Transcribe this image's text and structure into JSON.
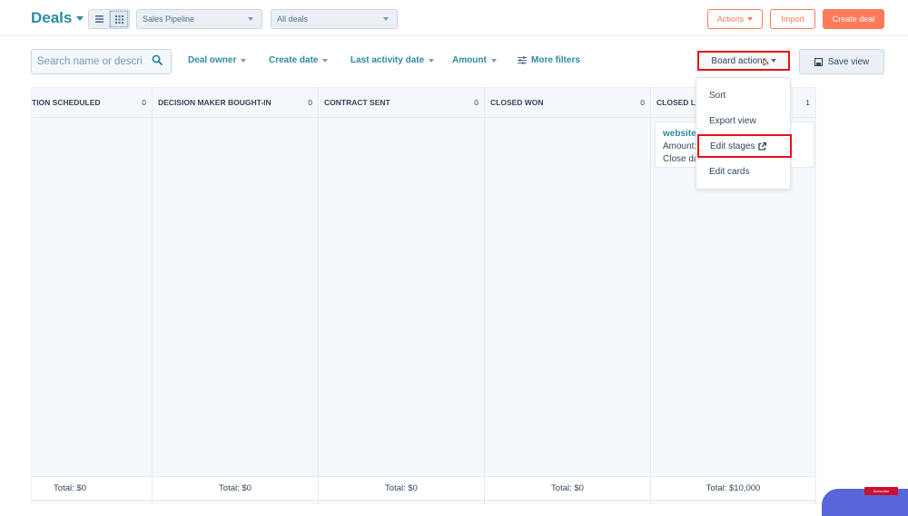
{
  "header": {
    "title": "Deals",
    "view_toggle": [
      {
        "icon": "list-view-icon",
        "active": false
      },
      {
        "icon": "board-view-icon",
        "active": true
      }
    ],
    "pipeline_select": {
      "value": "Sales Pipeline"
    },
    "deals_select": {
      "value": "All deals"
    },
    "actions_label": "Actions",
    "import_label": "Import",
    "create_label": "Create deal"
  },
  "filters": {
    "search_placeholder": "Search name or descri",
    "search_value": "",
    "deal_owner": "Deal owner",
    "create_date": "Create date",
    "last_activity_date": "Last activity date",
    "amount": "Amount",
    "more_filters": "More filters",
    "board_actions": "Board actions",
    "save_view": "Save view"
  },
  "board": {
    "columns": [
      {
        "name": "TION SCHEDULED",
        "count": "0",
        "total": "Total: $0"
      },
      {
        "name": "DECISION MAKER BOUGHT-IN",
        "count": "0",
        "total": "Total: $0"
      },
      {
        "name": "CONTRACT SENT",
        "count": "0",
        "total": "Total: $0"
      },
      {
        "name": "CLOSED WON",
        "count": "0",
        "total": "Total: $0"
      },
      {
        "name": "CLOSED LOST",
        "count": "1",
        "total": "Total: $10,000"
      }
    ],
    "card": {
      "name": "website",
      "amount_label": "Amount:",
      "close_label": "Close date:"
    }
  },
  "board_menu": {
    "items": [
      {
        "label": "Sort"
      },
      {
        "label": "Export view"
      },
      {
        "label": "Edit stages",
        "icon": "external-link-icon",
        "highlighted": true
      },
      {
        "label": "Edit cards"
      }
    ]
  },
  "overlay": {
    "subscribe_label": "Subscribe"
  },
  "colors": {
    "accent": "#2f8aa3",
    "primary": "#ff7a59",
    "highlight": "#e8101b"
  }
}
